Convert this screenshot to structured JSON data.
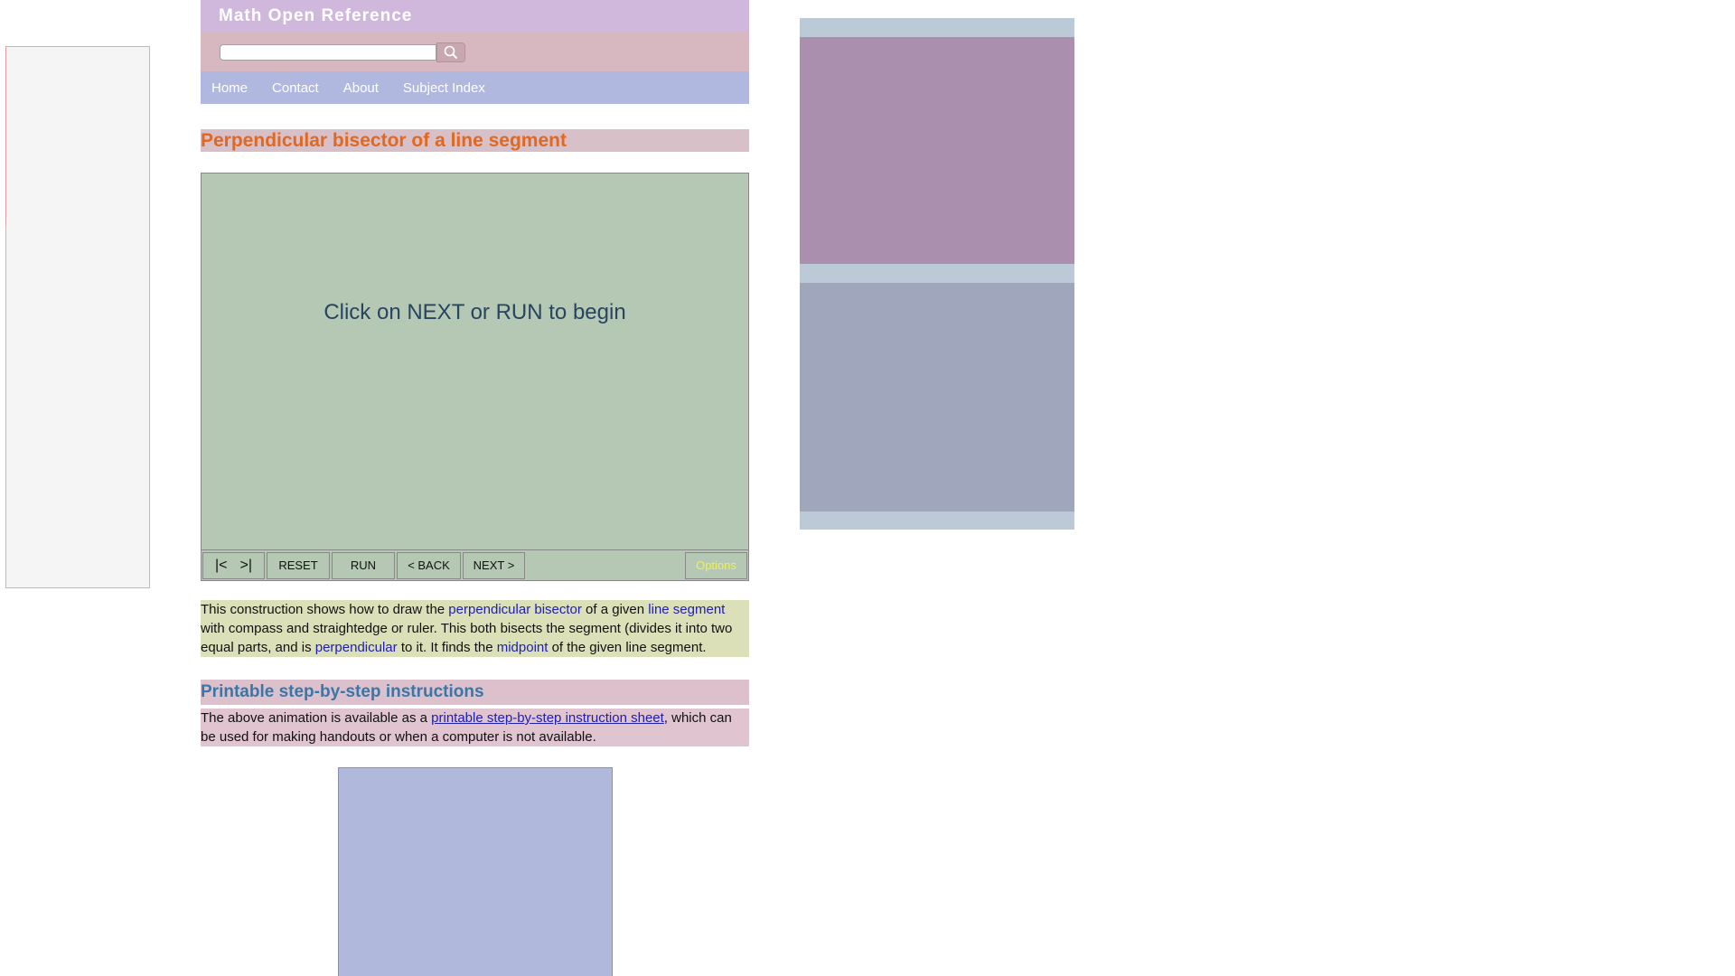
{
  "site": {
    "title": "Math Open Reference"
  },
  "search": {
    "value": "",
    "placeholder": "",
    "icon": "search-icon"
  },
  "nav": {
    "items": [
      {
        "label": "Home"
      },
      {
        "label": "Contact"
      },
      {
        "label": "About"
      },
      {
        "label": "Subject Index"
      }
    ]
  },
  "page": {
    "title": "Perpendicular bisector of a line segment"
  },
  "applet": {
    "message": "Click on NEXT or RUN to begin",
    "controls": {
      "first": "|<",
      "last": ">|",
      "reset": "RESET",
      "run": "RUN",
      "back": "< BACK",
      "next": "NEXT >",
      "options": "Options"
    }
  },
  "description": {
    "t1": "This construction shows how to draw the ",
    "link1": "perpendicular bisector",
    "t2": " of a given ",
    "link2": "line segment",
    "t3": " with compass and straightedge or ruler. This both bisects the segment (divides it into two equal parts, and is ",
    "link3": "perpendicular",
    "t4": " to it. It finds the ",
    "link4": "midpoint",
    "t5": " of the given line segment."
  },
  "printable": {
    "heading": "Printable step-by-step instructions",
    "t1": "The above animation is available as a ",
    "link": "printable step-by-step instruction sheet",
    "t2": ", which can be used for making handouts or when a computer is not available."
  },
  "colors": {
    "title_bar": "#d0b8dc",
    "search_bar": "#d8b8c0",
    "nav_bar": "#b0b8e0",
    "page_title": "#e06820",
    "applet_bg": "#b4c8b4",
    "link": "#2020b0",
    "section_head": "#3878a8",
    "options_text": "#f0f050"
  }
}
